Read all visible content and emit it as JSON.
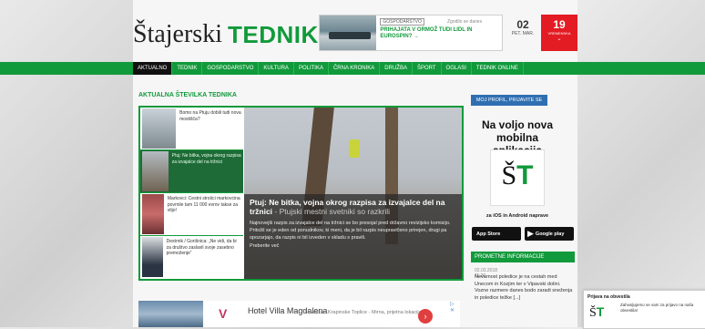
{
  "colors": {
    "brand_green": "#119a3b",
    "nav_active": "#111111",
    "weather_red": "#e31b23",
    "profile_blue": "#2f6fb1"
  },
  "header": {
    "logo_part1": "Štajerski",
    "logo_part2": "TEDNIK",
    "promo": {
      "category": "GOSPODARSTVO",
      "date": "Zgodilo se danes",
      "title": "PRIHAJATA V ORMOŽ TUDI LIDL IN EUROSPIN? →"
    },
    "date": {
      "day": "02",
      "label": "PET. MAR."
    },
    "weather": {
      "temp": "19",
      "label": "VREMENSKA",
      "arrow": "⌄"
    }
  },
  "nav": {
    "items": [
      "AKTUALNO",
      "TEDNIK",
      "GOSPODARSTVO",
      "KULTURA",
      "POLITIKA",
      "ČRNA KRONIKA",
      "DRUŽBA",
      "ŠPORT",
      "OGLASI",
      "TEDNIK ONLINE"
    ]
  },
  "section": {
    "title": "AKTUALNA ŠTEVILKA TEDNIKA"
  },
  "thumbs": [
    {
      "text": "Bomo na Ptuju dobili tudi nova mostišča?"
    },
    {
      "text": "Ptuj: Ne bitka, vojna okrog razpisa za izvajalce del na tržnici"
    },
    {
      "text": "Markovci: Cestni strošci markovcina povrnile tam 11 000 evrov takse za vlijo!"
    },
    {
      "text": "Destrnik / Gorišnica: „Ne vidi, da bi za društvo zaslavil svoje zasebno premoženje“"
    }
  ],
  "featured": {
    "title": "Ptuj: Ne bitka, vojna okrog razpisa za izvajalce del na tržnici",
    "subtitle": "- Ptujski mestni svetniki so razkrili",
    "text": "Najnovejši razpis za izvajalce del na tržnici se bo presojal pred državno revizijsko komisijo. Pritožil se je eden od ponudnikov, ki meni, da je bil razpis neupravičeno prirejen, drugi pa opozarjajo, da razpis ni bil izveden v skladu s pravili.",
    "more": "Preberite več"
  },
  "sidebar": {
    "profile_button": "MOJ PROFIL, PRIJAVITE SE",
    "app_title": "Na voljo nova mobilna aplikacija",
    "app_logo_s": "Š",
    "app_logo_t": "T",
    "app_sub": "za iOS in Android naprave",
    "appstore": "App Store",
    "googleplay": "Google play",
    "traffic_title": "PROMETNE INFORMACIJE",
    "traffic_date": "02.03.2018 11:20",
    "traffic_text": "Nevarnost poledice je na cestah med Unecom in Kozjim ter v Vipavski dolini. Vozne razmere danes bodo zaradi sneženja in poledice težke [...]"
  },
  "ad": {
    "title": "Hotel Villa Magdalena",
    "sub": "Hrvaška - Krapinske Toplice - Mirna, prijetna lokacija",
    "arrow": "›",
    "close": "▷ ✕"
  },
  "notification": {
    "title": "Prijava na obvestila",
    "text": "Zahvaljujemo se vam za prijavo na naša obvestila!"
  }
}
